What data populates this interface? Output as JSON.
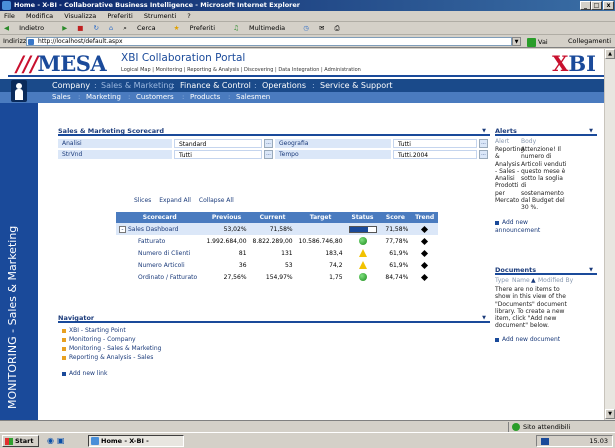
{
  "window": {
    "title": "Home - X-BI - Collaborative Business Intelligence - Microsoft Internet Explorer",
    "buttons": [
      "_",
      "□",
      "x"
    ]
  },
  "menubar": [
    "File",
    "Modifica",
    "Visualizza",
    "Preferiti",
    "Strumenti",
    "?"
  ],
  "toolbar": [
    "Indietro",
    "Cerca",
    "Preferiti",
    "Multimedia"
  ],
  "address": {
    "label": "Indirizzo",
    "value": "http://localhost/default.aspx",
    "go": "Vai",
    "links": "Collegamenti"
  },
  "portal": {
    "logo_left_prefix": "///",
    "logo_left": "MESA",
    "title": "XBI Collaboration Portal",
    "links": "Logical Map | Monitoring | Reporting & Analysis | Discovering | Data Integration | Administration",
    "logo_right_prefix": "X",
    "logo_right": "BI"
  },
  "nav1": [
    "Company",
    "Sales & Marketing",
    "Finance & Control",
    "Operations",
    "Service & Support"
  ],
  "nav2": [
    "Sales",
    "Marketing",
    "Customers",
    "Products",
    "Salesmen"
  ],
  "sidebar_text": "MONITORING - Sales & Marketing",
  "scorecard": {
    "title": "Sales & Marketing Scorecard",
    "filters": [
      {
        "label": "Analisi",
        "value": "Standard"
      },
      {
        "label": "Geografia",
        "value": "Tutti"
      },
      {
        "label": "StrVnd",
        "value": "Tutti"
      },
      {
        "label": "Tempo",
        "value": "Tutti.2004"
      }
    ],
    "actions": [
      "Slices",
      "Expand All",
      "Collapse All"
    ],
    "columns": [
      "Scorecard",
      "Previous",
      "Current",
      "Target",
      "Status",
      "Score",
      "Trend"
    ],
    "rows": [
      {
        "name": "Sales Dashboard",
        "previous": "53,02%",
        "current": "71,58%",
        "target": "",
        "status": "bar",
        "bar": 0.72,
        "score": "71,58%",
        "trend": "pin",
        "highlight": true
      },
      {
        "name": "Fatturato",
        "previous": "1.992.684,00",
        "current": "8.822.289,00",
        "target": "10.586.746,80",
        "status": "green",
        "score": "77,78%",
        "trend": "pin"
      },
      {
        "name": "Numero di Clienti",
        "previous": "81",
        "current": "131",
        "target": "183,4",
        "status": "warn",
        "score": "61,9%",
        "trend": "pin"
      },
      {
        "name": "Numero Articoli",
        "previous": "36",
        "current": "53",
        "target": "74,2",
        "status": "warn",
        "score": "61,9%",
        "trend": "pin"
      },
      {
        "name": "Ordinato / Fatturato",
        "previous": "27,56%",
        "current": "154,97%",
        "target": "1,75",
        "status": "green",
        "score": "84,74%",
        "trend": "pin"
      }
    ]
  },
  "navigator": {
    "title": "Navigator",
    "items": [
      "XBI - Starting Point",
      "Monitoring - Company",
      "Monitoring - Sales & Marketing",
      "Reporting & Analysis - Sales"
    ],
    "add_link": "Add new link"
  },
  "alerts": {
    "title": "Alerts",
    "col_alert": "Alert",
    "col_body": "Body",
    "alert_lines": [
      "Reporting",
      "& Analysis",
      "- Sales -",
      "Analisi",
      "Prodotti",
      "per",
      "Mercato"
    ],
    "body_lines": [
      "Attenzione! Il",
      "numero di",
      "Articoli venduti",
      "questo mese è",
      "sotto la soglia",
      "di",
      "sostenamento",
      "dal Budget del",
      "30 %."
    ],
    "add_link": "Add new announcement",
    "add_lines": [
      "Add new",
      "announcement"
    ]
  },
  "documents": {
    "title": "Documents",
    "col_type": "Type",
    "col_name": "Name",
    "col_modified": "Modified By",
    "empty_lines": [
      "There are no items to",
      "show in this view of the",
      "\"Documents\" document",
      "library. To create a new",
      "item, click \"Add new",
      "document\" below."
    ],
    "add_link": "Add new document"
  },
  "statusbar": {
    "zone": "Sito attendibili"
  },
  "taskbar": {
    "start": "Start",
    "task": "Home - X-BI - Collabo...",
    "clock": "15.03"
  }
}
